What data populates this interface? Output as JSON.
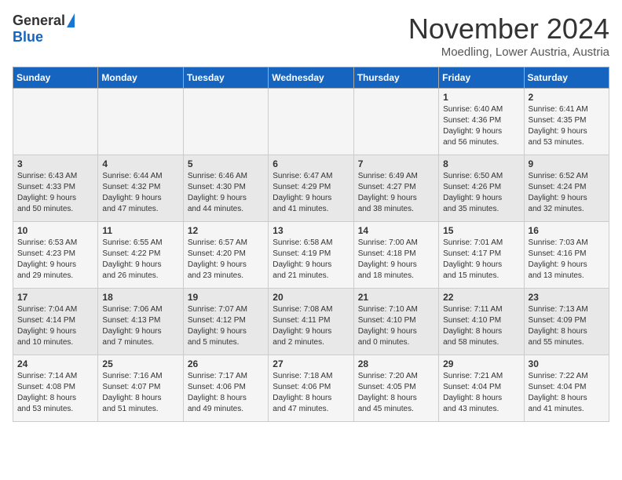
{
  "header": {
    "logo_general": "General",
    "logo_blue": "Blue",
    "month_title": "November 2024",
    "location": "Moedling, Lower Austria, Austria"
  },
  "days_of_week": [
    "Sunday",
    "Monday",
    "Tuesday",
    "Wednesday",
    "Thursday",
    "Friday",
    "Saturday"
  ],
  "weeks": [
    [
      {
        "day": "",
        "info": ""
      },
      {
        "day": "",
        "info": ""
      },
      {
        "day": "",
        "info": ""
      },
      {
        "day": "",
        "info": ""
      },
      {
        "day": "",
        "info": ""
      },
      {
        "day": "1",
        "info": "Sunrise: 6:40 AM\nSunset: 4:36 PM\nDaylight: 9 hours\nand 56 minutes."
      },
      {
        "day": "2",
        "info": "Sunrise: 6:41 AM\nSunset: 4:35 PM\nDaylight: 9 hours\nand 53 minutes."
      }
    ],
    [
      {
        "day": "3",
        "info": "Sunrise: 6:43 AM\nSunset: 4:33 PM\nDaylight: 9 hours\nand 50 minutes."
      },
      {
        "day": "4",
        "info": "Sunrise: 6:44 AM\nSunset: 4:32 PM\nDaylight: 9 hours\nand 47 minutes."
      },
      {
        "day": "5",
        "info": "Sunrise: 6:46 AM\nSunset: 4:30 PM\nDaylight: 9 hours\nand 44 minutes."
      },
      {
        "day": "6",
        "info": "Sunrise: 6:47 AM\nSunset: 4:29 PM\nDaylight: 9 hours\nand 41 minutes."
      },
      {
        "day": "7",
        "info": "Sunrise: 6:49 AM\nSunset: 4:27 PM\nDaylight: 9 hours\nand 38 minutes."
      },
      {
        "day": "8",
        "info": "Sunrise: 6:50 AM\nSunset: 4:26 PM\nDaylight: 9 hours\nand 35 minutes."
      },
      {
        "day": "9",
        "info": "Sunrise: 6:52 AM\nSunset: 4:24 PM\nDaylight: 9 hours\nand 32 minutes."
      }
    ],
    [
      {
        "day": "10",
        "info": "Sunrise: 6:53 AM\nSunset: 4:23 PM\nDaylight: 9 hours\nand 29 minutes."
      },
      {
        "day": "11",
        "info": "Sunrise: 6:55 AM\nSunset: 4:22 PM\nDaylight: 9 hours\nand 26 minutes."
      },
      {
        "day": "12",
        "info": "Sunrise: 6:57 AM\nSunset: 4:20 PM\nDaylight: 9 hours\nand 23 minutes."
      },
      {
        "day": "13",
        "info": "Sunrise: 6:58 AM\nSunset: 4:19 PM\nDaylight: 9 hours\nand 21 minutes."
      },
      {
        "day": "14",
        "info": "Sunrise: 7:00 AM\nSunset: 4:18 PM\nDaylight: 9 hours\nand 18 minutes."
      },
      {
        "day": "15",
        "info": "Sunrise: 7:01 AM\nSunset: 4:17 PM\nDaylight: 9 hours\nand 15 minutes."
      },
      {
        "day": "16",
        "info": "Sunrise: 7:03 AM\nSunset: 4:16 PM\nDaylight: 9 hours\nand 13 minutes."
      }
    ],
    [
      {
        "day": "17",
        "info": "Sunrise: 7:04 AM\nSunset: 4:14 PM\nDaylight: 9 hours\nand 10 minutes."
      },
      {
        "day": "18",
        "info": "Sunrise: 7:06 AM\nSunset: 4:13 PM\nDaylight: 9 hours\nand 7 minutes."
      },
      {
        "day": "19",
        "info": "Sunrise: 7:07 AM\nSunset: 4:12 PM\nDaylight: 9 hours\nand 5 minutes."
      },
      {
        "day": "20",
        "info": "Sunrise: 7:08 AM\nSunset: 4:11 PM\nDaylight: 9 hours\nand 2 minutes."
      },
      {
        "day": "21",
        "info": "Sunrise: 7:10 AM\nSunset: 4:10 PM\nDaylight: 9 hours\nand 0 minutes."
      },
      {
        "day": "22",
        "info": "Sunrise: 7:11 AM\nSunset: 4:10 PM\nDaylight: 8 hours\nand 58 minutes."
      },
      {
        "day": "23",
        "info": "Sunrise: 7:13 AM\nSunset: 4:09 PM\nDaylight: 8 hours\nand 55 minutes."
      }
    ],
    [
      {
        "day": "24",
        "info": "Sunrise: 7:14 AM\nSunset: 4:08 PM\nDaylight: 8 hours\nand 53 minutes."
      },
      {
        "day": "25",
        "info": "Sunrise: 7:16 AM\nSunset: 4:07 PM\nDaylight: 8 hours\nand 51 minutes."
      },
      {
        "day": "26",
        "info": "Sunrise: 7:17 AM\nSunset: 4:06 PM\nDaylight: 8 hours\nand 49 minutes."
      },
      {
        "day": "27",
        "info": "Sunrise: 7:18 AM\nSunset: 4:06 PM\nDaylight: 8 hours\nand 47 minutes."
      },
      {
        "day": "28",
        "info": "Sunrise: 7:20 AM\nSunset: 4:05 PM\nDaylight: 8 hours\nand 45 minutes."
      },
      {
        "day": "29",
        "info": "Sunrise: 7:21 AM\nSunset: 4:04 PM\nDaylight: 8 hours\nand 43 minutes."
      },
      {
        "day": "30",
        "info": "Sunrise: 7:22 AM\nSunset: 4:04 PM\nDaylight: 8 hours\nand 41 minutes."
      }
    ]
  ]
}
